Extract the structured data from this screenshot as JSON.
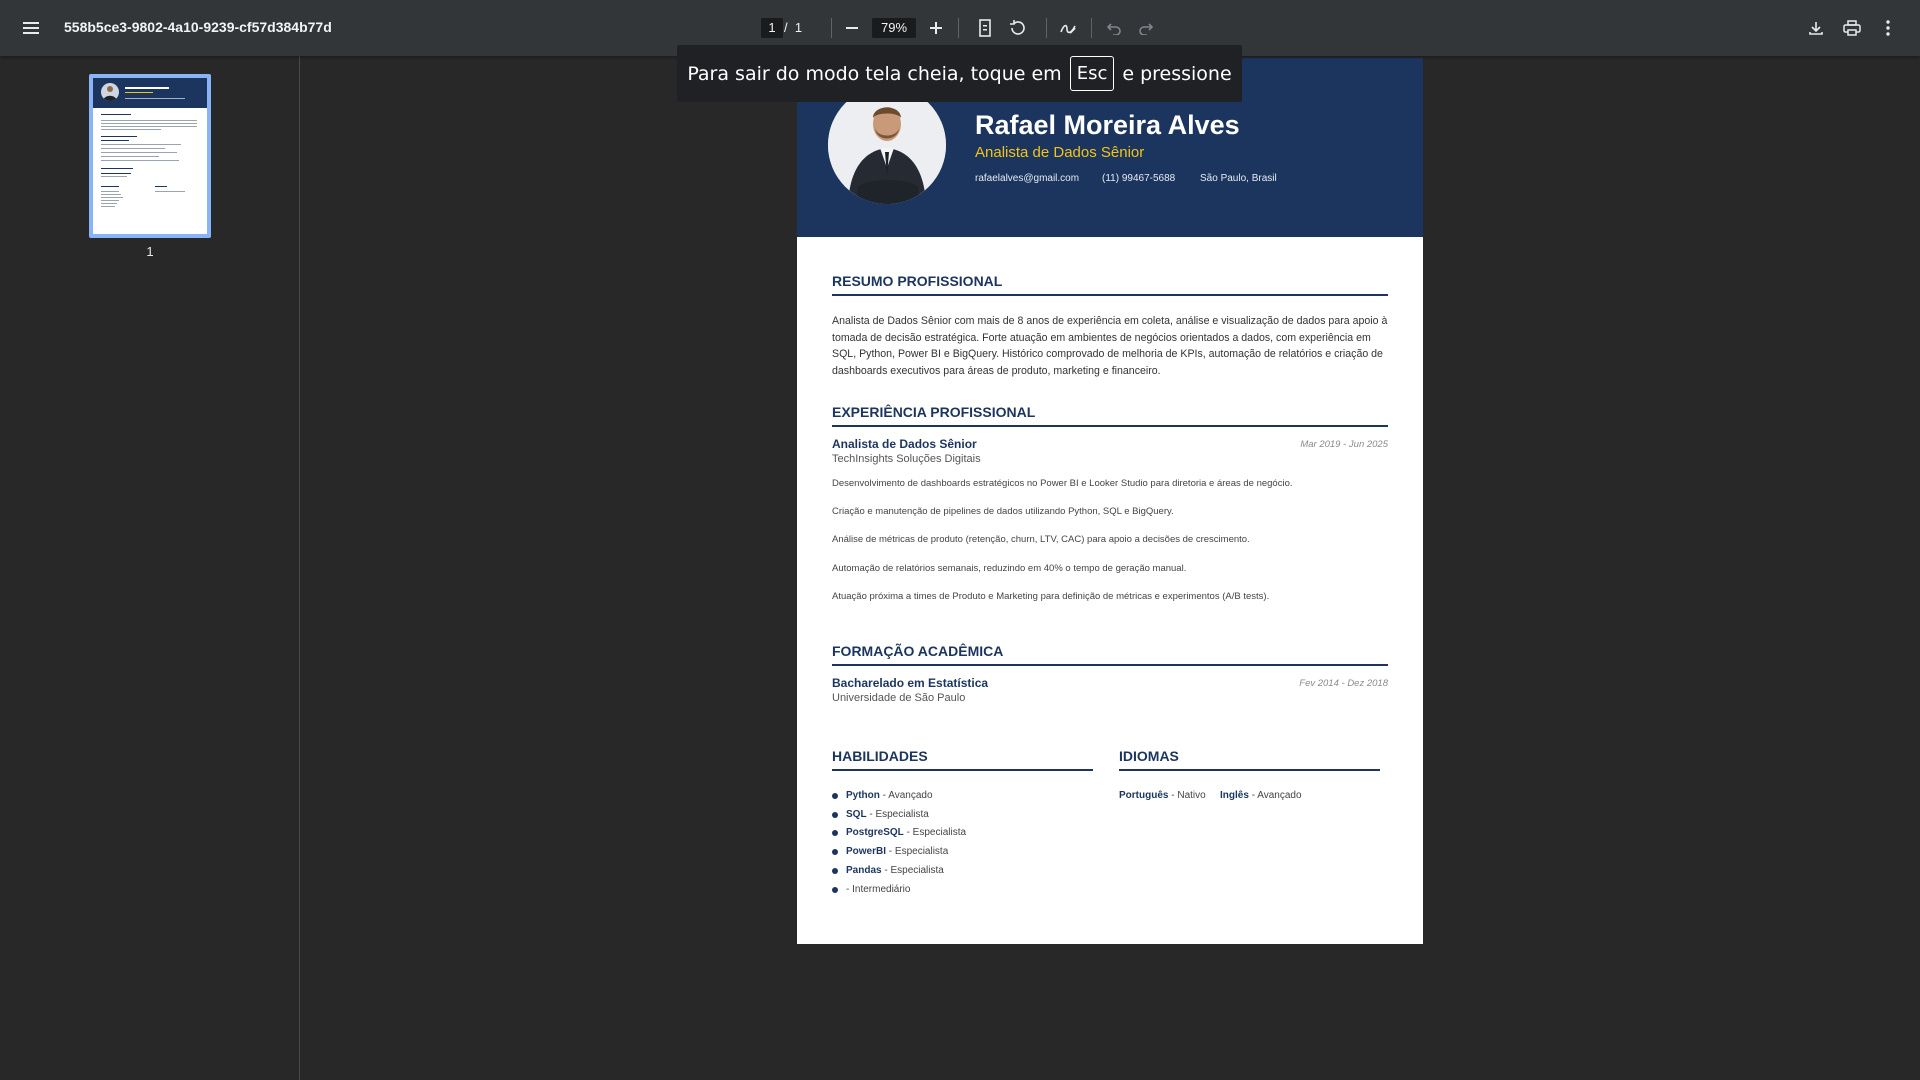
{
  "toolbar": {
    "doc_title": "558b5ce3-9802-4a10-9239-cf57d384b77d",
    "current_page": "1",
    "page_separator": "/",
    "total_pages": "1",
    "zoom": "79%"
  },
  "sidebar": {
    "thumbnail_page_number": "1"
  },
  "toast": {
    "text_before": "Para sair do modo tela cheia, toque em",
    "key": "Esc",
    "text_after": "e pressione"
  },
  "resume": {
    "name": "Rafael Moreira Alves",
    "role": "Analista de Dados Sênior",
    "email": "rafaelalves@gmail.com",
    "phone": "(11) 99467-5688",
    "location": "São Paulo, Brasil",
    "summary_title": "RESUMO PROFISSIONAL",
    "summary": "Analista de Dados Sênior com mais de 8 anos de experiência em coleta, análise e visualização de dados para apoio à tomada de decisão estratégica. Forte atuação em ambientes de negócios orientados a dados, com experiência em SQL, Python, Power BI e BigQuery. Histórico comprovado de melhoria de KPIs, automação de relatórios e criação de dashboards executivos para áreas de produto, marketing e financeiro.",
    "experience_title": "EXPERIÊNCIA PROFISSIONAL",
    "job": {
      "title": "Analista de Dados Sênior",
      "company": "TechInsights Soluções Digitais",
      "dates": "Mar 2019 - Jun 2025",
      "bullets": [
        "Desenvolvimento de dashboards estratégicos no Power BI e Looker Studio para diretoria e áreas de negócio.",
        "Criação e manutenção de pipelines de dados utilizando Python, SQL e BigQuery.",
        "Análise de métricas de produto (retenção, churn, LTV, CAC) para apoio a decisões de crescimento.",
        "Automação de relatórios semanais, reduzindo em 40% o tempo de geração manual.",
        "Atuação próxima a times de Produto e Marketing para definição de métricas e experimentos (A/B tests)."
      ]
    },
    "education_title": "FORMAÇÃO ACADÊMICA",
    "education": {
      "degree": "Bacharelado em Estatística",
      "school": "Universidade de São Paulo",
      "dates": "Fev 2014 - Dez 2018"
    },
    "skills_title": "HABILIDADES",
    "skills": [
      {
        "name": "Python",
        "level": "- Avançado"
      },
      {
        "name": "SQL",
        "level": "- Especialista"
      },
      {
        "name": "PostgreSQL",
        "level": "- Especialista"
      },
      {
        "name": "PowerBI",
        "level": "- Especialista"
      },
      {
        "name": "Pandas",
        "level": "- Especialista"
      },
      {
        "name": "",
        "level": "- Intermediário"
      }
    ],
    "languages_title": "IDIOMAS",
    "languages": [
      {
        "name": "Português",
        "level": "- Nativo"
      },
      {
        "name": "Inglês",
        "level": "- Avançado"
      }
    ]
  },
  "colors": {
    "header_navy": "#1c355e",
    "accent_yellow": "#f2c417",
    "toolbar_bg": "#323639",
    "viewer_bg": "#282828"
  },
  "icons": [
    "menu-icon",
    "zoom-out-icon",
    "zoom-in-icon",
    "fit-page-icon",
    "rotate-icon",
    "annotate-icon",
    "undo-icon",
    "redo-icon",
    "download-icon",
    "print-icon",
    "more-icon"
  ]
}
